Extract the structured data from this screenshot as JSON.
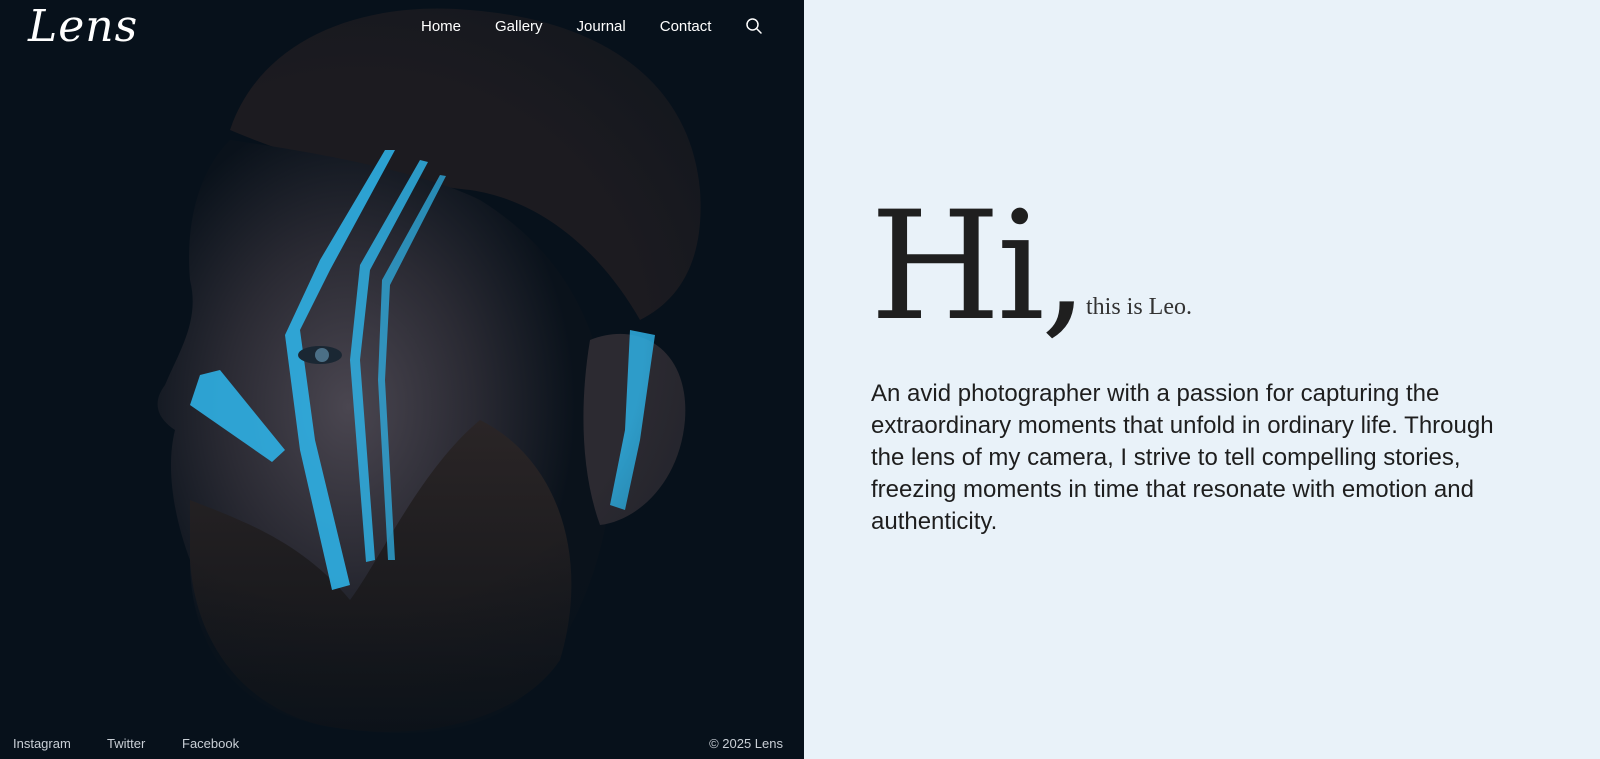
{
  "brand": {
    "logo_text": "Lens"
  },
  "nav": {
    "items": [
      {
        "label": "Home"
      },
      {
        "label": "Gallery"
      },
      {
        "label": "Journal"
      },
      {
        "label": "Contact"
      }
    ],
    "search_icon": "search-icon"
  },
  "hero_image": {
    "subject": "portrait-icon"
  },
  "footer": {
    "social": [
      {
        "label": "Instagram"
      },
      {
        "label": "Twitter"
      },
      {
        "label": "Facebook"
      }
    ],
    "copyright": "© 2025 Lens"
  },
  "intro": {
    "greeting": "Hi,",
    "subtitle": "this is Leo.",
    "bio": "An avid photographer with a passion for capturing the extraordinary moments that unfold in ordinary life. Through the lens of my camera, I strive to tell compelling stories, freezing moments in time that resonate with emotion and authenticity."
  },
  "colors": {
    "left_bg": "#07111b",
    "right_bg": "#e9f2f9",
    "accent_paint": "#2fb0e4",
    "text_dark": "#1f1f1f"
  }
}
